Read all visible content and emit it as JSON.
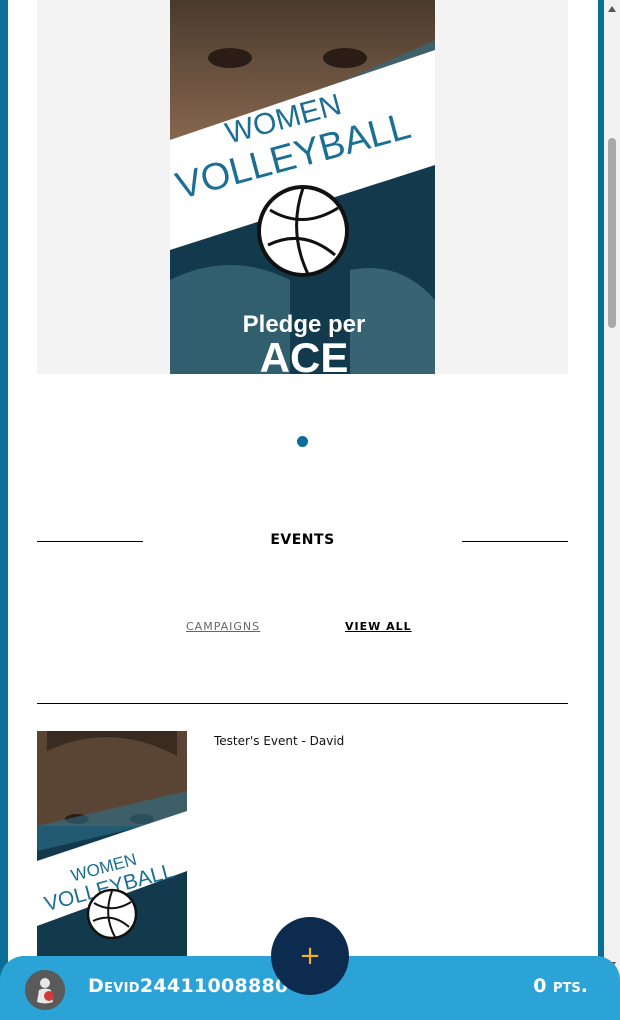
{
  "hero": {
    "poster": {
      "line1": "WOMEN",
      "line2": "VOLLEYBALL",
      "line3": "Pledge per",
      "line4": "ACE"
    }
  },
  "carousel": {
    "active_index": 1,
    "total": 1
  },
  "events": {
    "section_title": "EVENTS",
    "tabs": {
      "campaigns": "CAMPAIGNS",
      "view_all": "VIEW ALL"
    },
    "items": [
      {
        "title": "Tester's Event - David",
        "poster": {
          "line1": "WOMEN",
          "line2": "VOLLEYBALL"
        }
      }
    ]
  },
  "fab": {
    "label": "+"
  },
  "footer": {
    "username": "Devid24411008880",
    "points": "0 pts."
  },
  "colors": {
    "brand_blue": "#0a6e99",
    "bar_blue": "#2ba3d6",
    "fab_navy": "#0d2a4f",
    "fab_plus": "#f2b31c"
  }
}
